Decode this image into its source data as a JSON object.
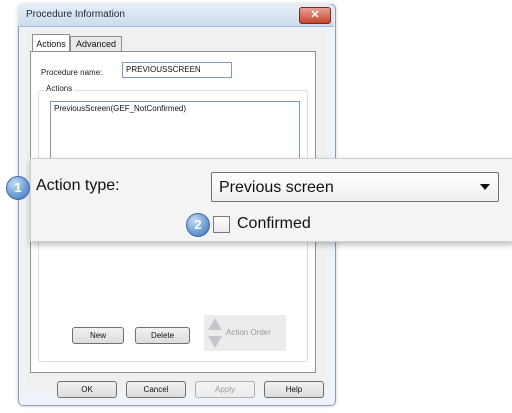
{
  "window": {
    "title": "Procedure Information",
    "close_glyph": "✕"
  },
  "tabs": [
    {
      "label": "Actions",
      "active": true
    },
    {
      "label": "Advanced",
      "active": false
    }
  ],
  "procedure": {
    "name_label": "Procedure name:",
    "name_value": "PREVIOUSSCREEN"
  },
  "actions": {
    "group_label": "Actions",
    "list_text": "PreviousScreen(GEF_NotConfirmed)",
    "new_label": "New",
    "delete_label": "Delete",
    "order_label": "Action Order"
  },
  "callout": {
    "badge1": "1",
    "action_type_label": "Action type:",
    "action_type_value": "Previous screen",
    "badge2": "2",
    "confirmed_label": "Confirmed",
    "confirmed_checked": false
  },
  "footer": {
    "ok": "OK",
    "cancel": "Cancel",
    "apply": "Apply",
    "help": "Help"
  },
  "colors": {
    "badge": "#5b8fd0",
    "close": "#c8452d",
    "window_border": "#8a9db5"
  }
}
